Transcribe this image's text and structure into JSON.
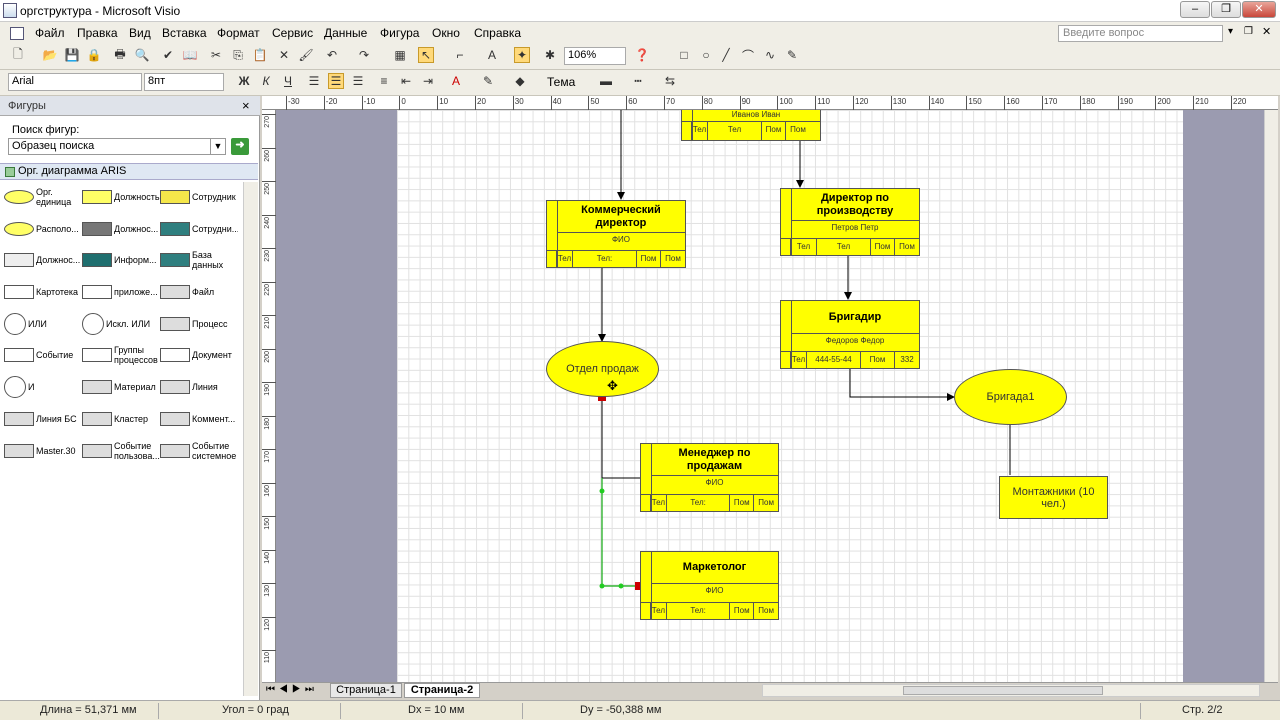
{
  "window": {
    "title": "оргструктура - Microsoft Visio"
  },
  "menu": [
    "Файл",
    "Правка",
    "Вид",
    "Вставка",
    "Формат",
    "Сервис",
    "Данные",
    "Фигура",
    "Окно",
    "Справка"
  ],
  "help": {
    "placeholder": "Введите вопрос"
  },
  "toolbar": {
    "zoom": "106%",
    "font": "Arial",
    "font_size": "8пт",
    "theme_label": "Тема"
  },
  "panel": {
    "title": "Фигуры",
    "search_label": "Поиск фигур:",
    "search_value": "Образец поиска",
    "stencil": "Орг. диаграмма ARIS",
    "shapes": [
      [
        "Орг. единица",
        "Должность",
        "Сотрудник"
      ],
      [
        "Располо...",
        "Должнос...",
        "Сотрудни..."
      ],
      [
        "Должнос...",
        "Информ...",
        "База данных"
      ],
      [
        "Картотека",
        "приложе...",
        "Файл"
      ],
      [
        "ИЛИ",
        "Искл. ИЛИ",
        "Процесс"
      ],
      [
        "Событие",
        "Группы процессов",
        "Документ"
      ],
      [
        "И",
        "Материал",
        "Линия"
      ],
      [
        "Линия БС",
        "Кластер",
        "Коммент..."
      ],
      [
        "Master.30",
        "Событие пользова...",
        "Событие системное"
      ]
    ]
  },
  "ruler": {
    "h": [
      "-30",
      "-20",
      "-10",
      "0",
      "10",
      "20",
      "30",
      "40",
      "50",
      "60",
      "70",
      "80",
      "90",
      "100",
      "110",
      "120",
      "130",
      "140",
      "150",
      "160",
      "170",
      "180",
      "190",
      "200",
      "210",
      "220"
    ],
    "v": [
      "270",
      "260",
      "250",
      "240",
      "230",
      "220",
      "210",
      "200",
      "190",
      "180",
      "170",
      "160",
      "150",
      "140",
      "130",
      "120",
      "110"
    ]
  },
  "diagram": {
    "top": {
      "name": "Иванов Иван",
      "cells": [
        "Тел",
        "Тел",
        "Пом",
        "Пом"
      ]
    },
    "commercial": {
      "title": "Коммерческий директор",
      "fio": "ФИО",
      "cells": [
        "Тел",
        "Тел:",
        "Пом",
        "Пом"
      ]
    },
    "production": {
      "title": "Директор по производству",
      "fio": "Петров Петр",
      "cells": [
        "Тел",
        "Тел",
        "Пом",
        "Пом"
      ]
    },
    "brigadir": {
      "title": "Бригадир",
      "fio": "Федоров Федор",
      "cells": [
        "Тел",
        "444-55-44",
        "Пом",
        "332"
      ]
    },
    "sales_dept": {
      "label": "Отдел продаж"
    },
    "brigada": {
      "label": "Бригада1"
    },
    "installers": {
      "label": "Монтажники (10 чел.)"
    },
    "sales_manager": {
      "title": "Менеджер по продажам",
      "fio": "ФИО",
      "cells": [
        "Тел",
        "Тел:",
        "Пом",
        "Пом"
      ]
    },
    "marketer": {
      "title": "Маркетолог",
      "fio": "ФИО",
      "cells": [
        "Тел",
        "Тел:",
        "Пом",
        "Пом"
      ]
    }
  },
  "tabs": [
    "Страница-1",
    "Страница-2"
  ],
  "status": {
    "length": "Длина = 51,371 мм",
    "angle": "Угол = 0 град",
    "dx": "Dx = 10 мм",
    "dy": "Dy = -50,388 мм",
    "page": "Стр. 2/2"
  }
}
